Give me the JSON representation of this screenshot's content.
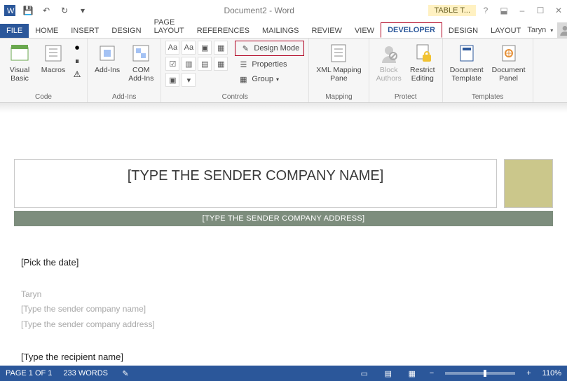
{
  "qat": {
    "tooltip": "Quick Access"
  },
  "title": "Document2 - Word",
  "tools_context": "TABLE T...",
  "tabs": {
    "file": "FILE",
    "items": [
      "HOME",
      "INSERT",
      "DESIGN",
      "PAGE LAYOUT",
      "REFERENCES",
      "MAILINGS",
      "REVIEW",
      "VIEW",
      "DEVELOPER",
      "DESIGN",
      "LAYOUT"
    ],
    "active_index": 8
  },
  "user": {
    "name": "Taryn"
  },
  "ribbon": {
    "groups": {
      "code": {
        "label": "Code",
        "visual_basic": "Visual\nBasic",
        "macros": "Macros"
      },
      "addins": {
        "label": "Add-Ins",
        "addins": "Add-Ins",
        "com": "COM\nAdd-Ins"
      },
      "controls": {
        "label": "Controls",
        "design_mode": "Design Mode",
        "properties": "Properties",
        "group": "Group"
      },
      "mapping": {
        "label": "Mapping",
        "xml": "XML Mapping\nPane"
      },
      "protect": {
        "label": "Protect",
        "block": "Block\nAuthors",
        "restrict": "Restrict\nEditing"
      },
      "templates": {
        "label": "Templates",
        "doc_template": "Document\nTemplate",
        "doc_panel": "Document\nPanel"
      }
    }
  },
  "document": {
    "company_name": "[TYPE THE SENDER COMPANY NAME]",
    "company_addr": "[TYPE THE SENDER COMPANY ADDRESS]",
    "date": "[Pick the date]",
    "sender_name": "Taryn",
    "sender_company": "[Type the sender company name]",
    "sender_address": "[Type the sender company address]",
    "recipient": "[Type the recipient name]"
  },
  "status": {
    "page": "PAGE 1 OF 1",
    "words": "233 WORDS",
    "zoom": "110%"
  }
}
